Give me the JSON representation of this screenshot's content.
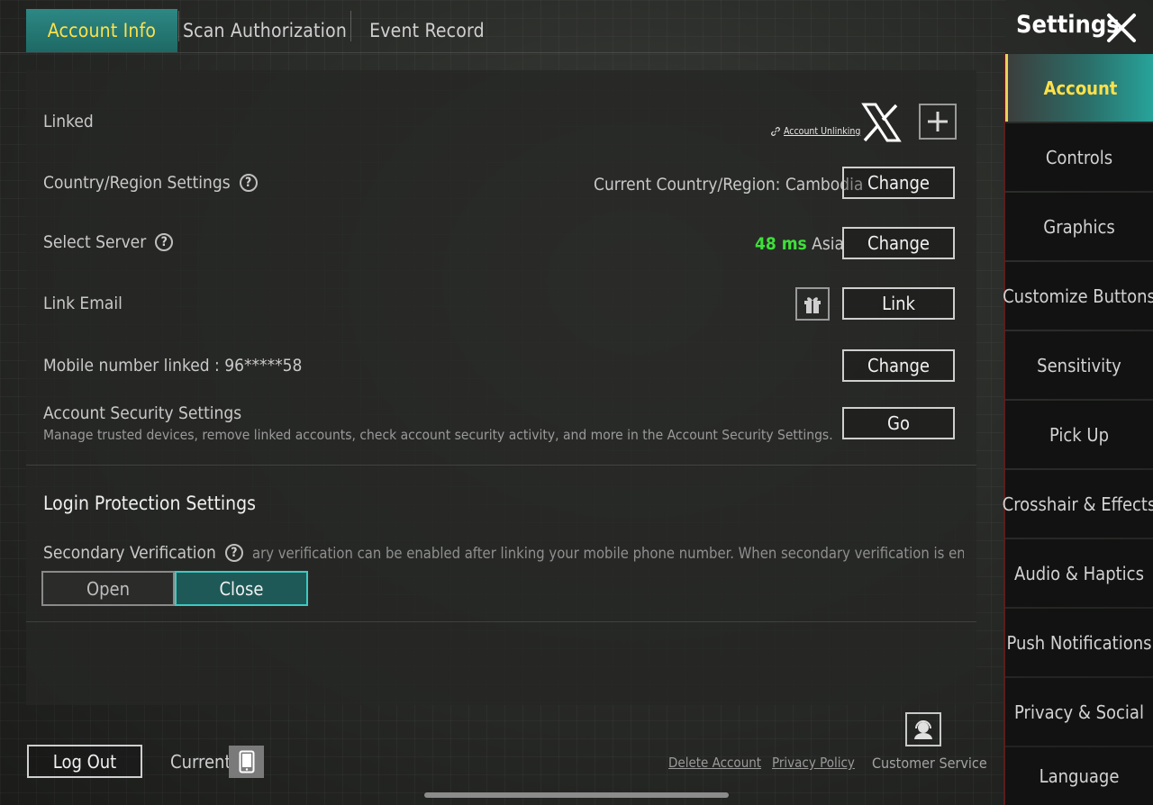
{
  "tabs": [
    {
      "label": "Account Info"
    },
    {
      "label": "Scan Authorization"
    },
    {
      "label": "Event Record"
    }
  ],
  "header": {
    "title": "Settings"
  },
  "sidebar": {
    "items": [
      {
        "label": "Account"
      },
      {
        "label": "Controls"
      },
      {
        "label": "Graphics"
      },
      {
        "label": "Customize Buttons"
      },
      {
        "label": "Sensitivity"
      },
      {
        "label": "Pick Up"
      },
      {
        "label": "Crosshair & Effects"
      },
      {
        "label": "Audio & Haptics"
      },
      {
        "label": "Push Notifications"
      },
      {
        "label": "Privacy & Social"
      },
      {
        "label": "Language"
      }
    ]
  },
  "account": {
    "linked_label": "Linked",
    "unlinking_label": "Account Unlinking",
    "country_label": "Country/Region Settings",
    "country_value": "Current Country/Region: Cambodia",
    "country_button": "Change",
    "server_label": "Select Server",
    "server_latency": "48 ms",
    "server_region": "Asia",
    "server_button": "Change",
    "email_label": "Link Email",
    "email_button": "Link",
    "mobile_label": "Mobile number linked : 96*****58",
    "mobile_button": "Change",
    "security_title": "Account Security Settings",
    "security_desc": "Manage trusted devices, remove linked accounts, check account security activity, and more in the Account Security Settings.",
    "security_button": "Go"
  },
  "login_protection": {
    "title": "Login Protection Settings",
    "secondary_label": "Secondary Verification",
    "secondary_desc": "ary verification can be enabled after linking your mobile phone number. When secondary verification is enabled, non-truste",
    "open_label": "Open",
    "close_label": "Close",
    "selected": "Close"
  },
  "footer": {
    "logout": "Log Out",
    "current": "Current",
    "delete_account": "Delete Account",
    "privacy_policy": "Privacy Policy",
    "customer_service": "Customer Service"
  },
  "icons": {
    "close": "close-icon",
    "help": "help-circle-icon",
    "link": "link-icon",
    "x_logo": "x-twitter-icon",
    "add": "plus-icon",
    "gift": "gift-icon",
    "phone": "phone-icon",
    "support": "customer-service-icon"
  },
  "colors": {
    "accent_teal": "#1e6965",
    "active_text": "#ffe14a",
    "latency_green": "#3ee03a"
  }
}
